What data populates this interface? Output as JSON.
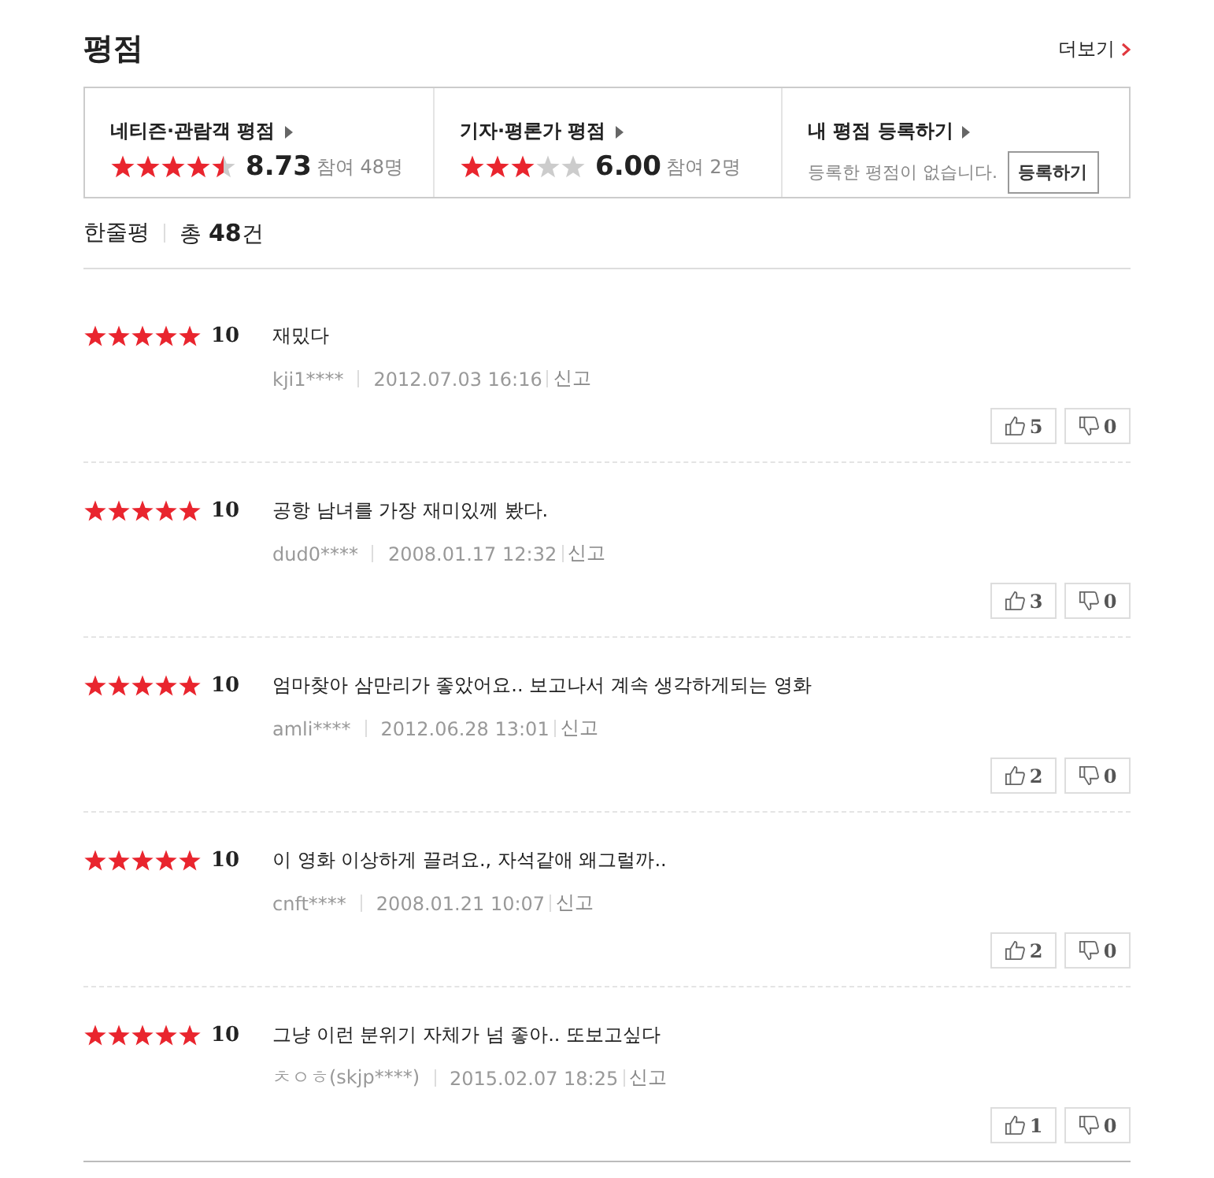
{
  "title": "평점",
  "more_link": "더보기",
  "summary": [
    {
      "kind": "score",
      "label": "네티즌·관람객 평점",
      "stars": 4.5,
      "score": "8.73",
      "participants": "참여 48명"
    },
    {
      "kind": "score",
      "label": "기자·평론가 평점",
      "stars": 3,
      "score": "6.00",
      "participants": "참여 2명"
    },
    {
      "kind": "register",
      "label": "내 평점 등록하기",
      "message": "등록한 평점이 없습니다.",
      "button": "등록하기"
    }
  ],
  "reviews_header": {
    "label": "한줄평",
    "total_prefix": "총",
    "total": "48",
    "total_suffix": "건"
  },
  "reviews": [
    {
      "stars": 5,
      "score": "10",
      "text": "재밌다",
      "user": "kji1****",
      "date": "2012.07.03 16:16",
      "report": "신고",
      "likes": "5",
      "dislikes": "0"
    },
    {
      "stars": 5,
      "score": "10",
      "text": "공항 남녀를 가장 재미있께 봤다.",
      "user": "dud0****",
      "date": "2008.01.17 12:32",
      "report": "신고",
      "likes": "3",
      "dislikes": "0"
    },
    {
      "stars": 5,
      "score": "10",
      "text": "엄마찾아 삼만리가 좋았어요.. 보고나서 계속 생각하게되는 영화",
      "user": "amli****",
      "date": "2012.06.28 13:01",
      "report": "신고",
      "likes": "2",
      "dislikes": "0"
    },
    {
      "stars": 5,
      "score": "10",
      "text": "이 영화 이상하게 끌려요., 자석같애 왜그럴까..",
      "user": "cnft****",
      "date": "2008.01.21 10:07",
      "report": "신고",
      "likes": "2",
      "dislikes": "0"
    },
    {
      "stars": 5,
      "score": "10",
      "text": "그냥 이런 분위기 자체가 넘 좋아.. 또보고싶다",
      "user": "ㅊㅇㅎ(skjp****)",
      "date": "2015.02.07 18:25",
      "report": "신고",
      "likes": "1",
      "dislikes": "0"
    }
  ]
}
